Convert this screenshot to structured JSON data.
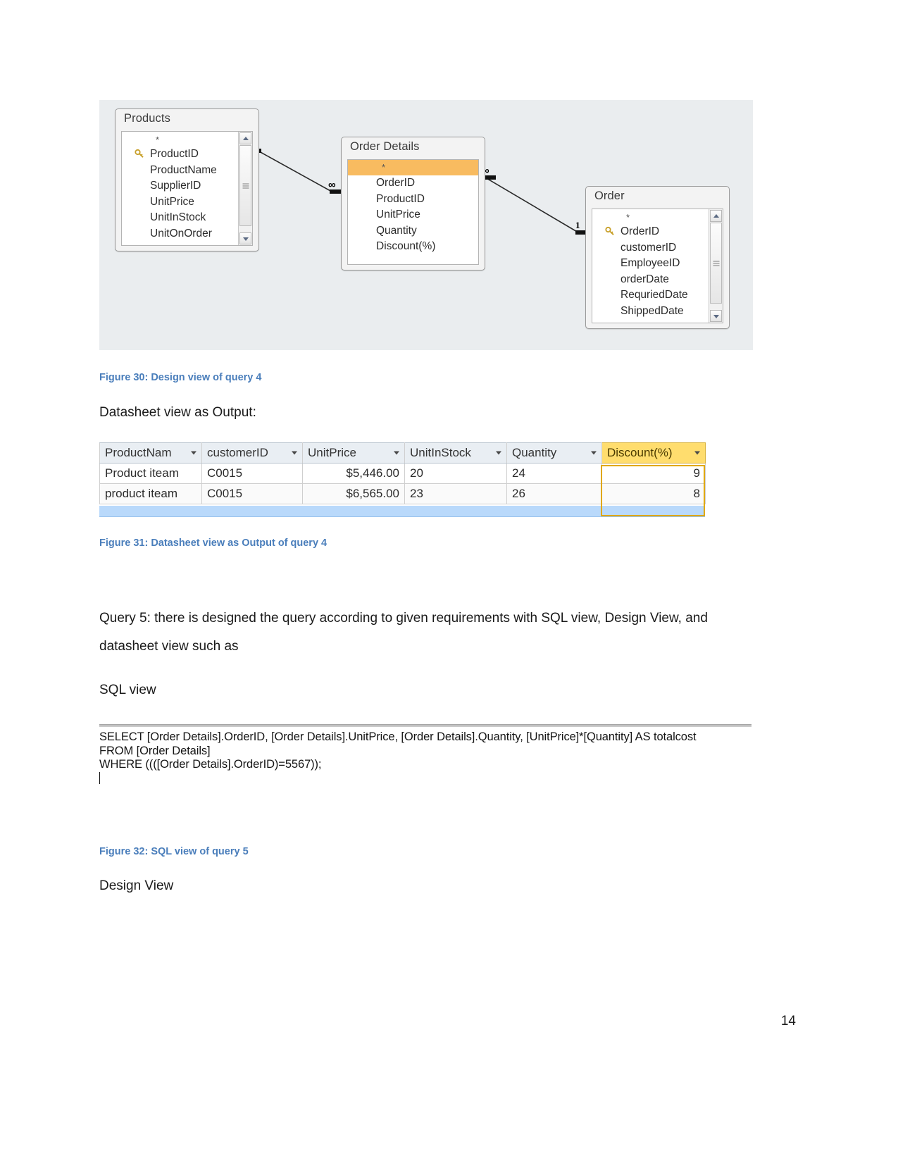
{
  "document": {
    "page_number": "14"
  },
  "figure30": {
    "caption": "Figure 30: Design view of query 4",
    "tables": [
      {
        "name": "Products",
        "fields": [
          "*",
          "ProductID",
          "ProductName",
          "SupplierID",
          "UnitPrice",
          "UnitInStock",
          "UnitOnOrder"
        ],
        "primary_key": "ProductID",
        "has_scrollbar": true
      },
      {
        "name": "Order Details",
        "fields": [
          "*",
          "OrderID",
          "ProductID",
          "UnitPrice",
          "Quantity",
          "Discount(%)"
        ],
        "highlighted_field": "*",
        "highlight_color": "#f8bb60",
        "has_scrollbar": false
      },
      {
        "name": "Order",
        "fields": [
          "*",
          "OrderID",
          "customerID",
          "EmployeeID",
          "orderDate",
          "RequriedDate",
          "ShippedDate"
        ],
        "primary_key": "OrderID",
        "has_scrollbar": true
      }
    ],
    "relationships": [
      {
        "from": "Products",
        "to": "Order Details",
        "left_label": "1",
        "right_label": "∞"
      },
      {
        "from": "Order Details",
        "to": "Order",
        "left_label": "∞",
        "right_label": "1"
      }
    ]
  },
  "intro_text": {
    "datasheet_label": "Datasheet view as Output:"
  },
  "figure31": {
    "caption": "Figure 31: Datasheet view as Output of query 4",
    "columns": [
      {
        "label": "ProductNam",
        "accent": false
      },
      {
        "label": "customerID",
        "accent": false
      },
      {
        "label": "UnitPrice",
        "accent": false
      },
      {
        "label": "UnitInStock",
        "accent": false
      },
      {
        "label": "Quantity",
        "accent": false
      },
      {
        "label": "Discount(%)",
        "accent": true
      }
    ],
    "rows": [
      [
        "Product iteam",
        "C0015",
        "$5,446.00",
        "20",
        "24",
        "9"
      ],
      [
        "product iteam",
        "C0015",
        "$6,565.00",
        "23",
        "26",
        "8"
      ]
    ],
    "accent_color": "#ffdd6e",
    "selection_color": "#b9d9fb"
  },
  "query5": {
    "paragraph_line1": "Query 5: there is designed the query according to given requirements with SQL view, Design View, and",
    "paragraph_line2": "datasheet view such as",
    "sql_view_label": "SQL view",
    "design_view_label": "Design View"
  },
  "figure32": {
    "caption": "Figure 32: SQL view of query 5",
    "sql_lines": [
      "SELECT [Order Details].OrderID, [Order Details].UnitPrice, [Order Details].Quantity, [UnitPrice]*[Quantity] AS totalcost",
      "FROM [Order Details]",
      "WHERE ((([Order Details].OrderID)=5567));"
    ]
  }
}
